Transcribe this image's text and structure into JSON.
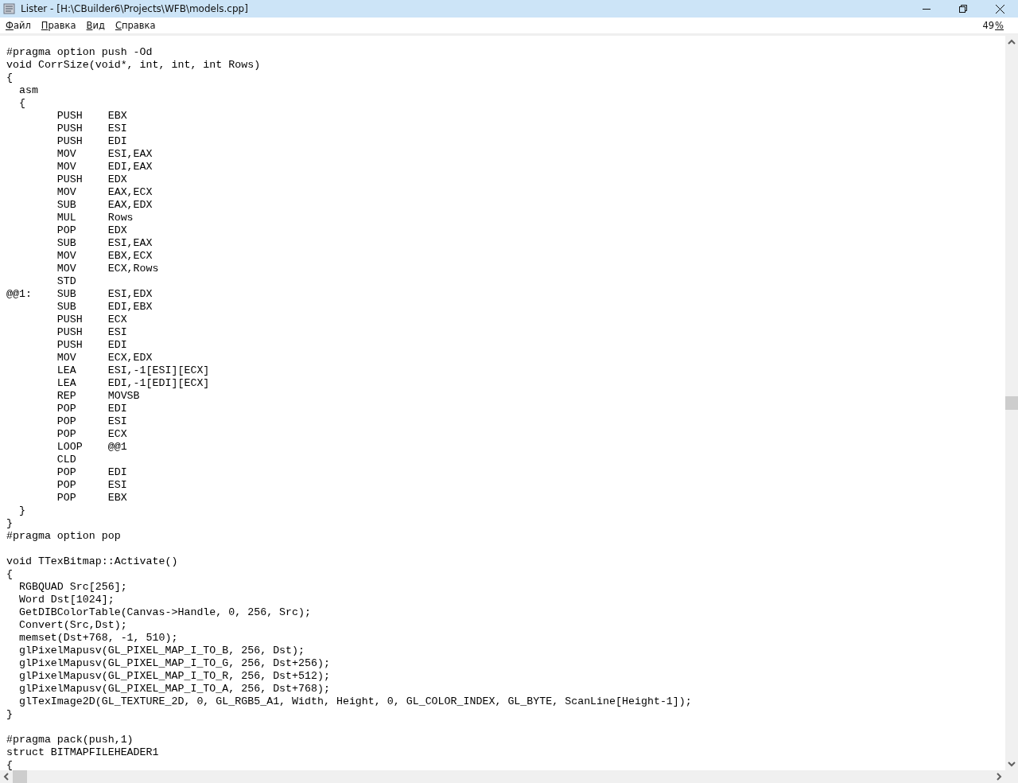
{
  "window": {
    "title": "Lister - [H:\\CBuilder6\\Projects\\WFB\\models.cpp]"
  },
  "menu": [
    {
      "label": "Файл"
    },
    {
      "label": "Правка"
    },
    {
      "label": "Вид"
    },
    {
      "label": "Справка"
    }
  ],
  "zoom": {
    "value": "49",
    "unit": "%"
  },
  "code_blocks": [
    [
      "#pragma option push -Od",
      "void CorrSize(void*, int, int, int Rows)",
      "{",
      "  asm",
      "  {",
      "        PUSH    EBX",
      "        PUSH    ESI",
      "        PUSH    EDI",
      "        MOV     ESI,EAX",
      "        MOV     EDI,EAX",
      "        PUSH    EDX",
      "        MOV     EAX,ECX",
      "        SUB     EAX,EDX",
      "        MUL     Rows",
      "        POP     EDX",
      "        SUB     ESI,EAX",
      "        MOV     EBX,ECX",
      "        MOV     ECX,Rows",
      "        STD",
      "@@1:    SUB     ESI,EDX",
      "        SUB     EDI,EBX",
      "        PUSH    ECX",
      "        PUSH    ESI",
      "        PUSH    EDI",
      "        MOV     ECX,EDX",
      "        LEA     ESI,-1[ESI][ECX]",
      "        LEA     EDI,-1[EDI][ECX]",
      "        REP     MOVSB",
      "        POP     EDI",
      "        POP     ESI",
      "        POP     ECX",
      "        LOOP    @@1",
      "        CLD",
      "        POP     EDI",
      "        POP     ESI",
      "        POP     EBX",
      "  }",
      "}",
      "#pragma option pop"
    ],
    [
      "void TTexBitmap::Activate()",
      "{",
      "  RGBQUAD Src[256];",
      "  Word Dst[1024];",
      "  GetDIBColorTable(Canvas->Handle, 0, 256, Src);",
      "  Convert(Src,Dst);",
      "  memset(Dst+768, -1, 510);",
      "  glPixelMapusv(GL_PIXEL_MAP_I_TO_B, 256, Dst);",
      "  glPixelMapusv(GL_PIXEL_MAP_I_TO_G, 256, Dst+256);",
      "  glPixelMapusv(GL_PIXEL_MAP_I_TO_R, 256, Dst+512);",
      "  glPixelMapusv(GL_PIXEL_MAP_I_TO_A, 256, Dst+768);",
      "  glTexImage2D(GL_TEXTURE_2D, 0, GL_RGB5_A1, Width, Height, 0, GL_COLOR_INDEX, GL_BYTE, ScanLine[Height-1]);",
      "}"
    ],
    [
      "#pragma pack(push,1)",
      "struct BITMAPFILEHEADER1",
      "{"
    ]
  ]
}
